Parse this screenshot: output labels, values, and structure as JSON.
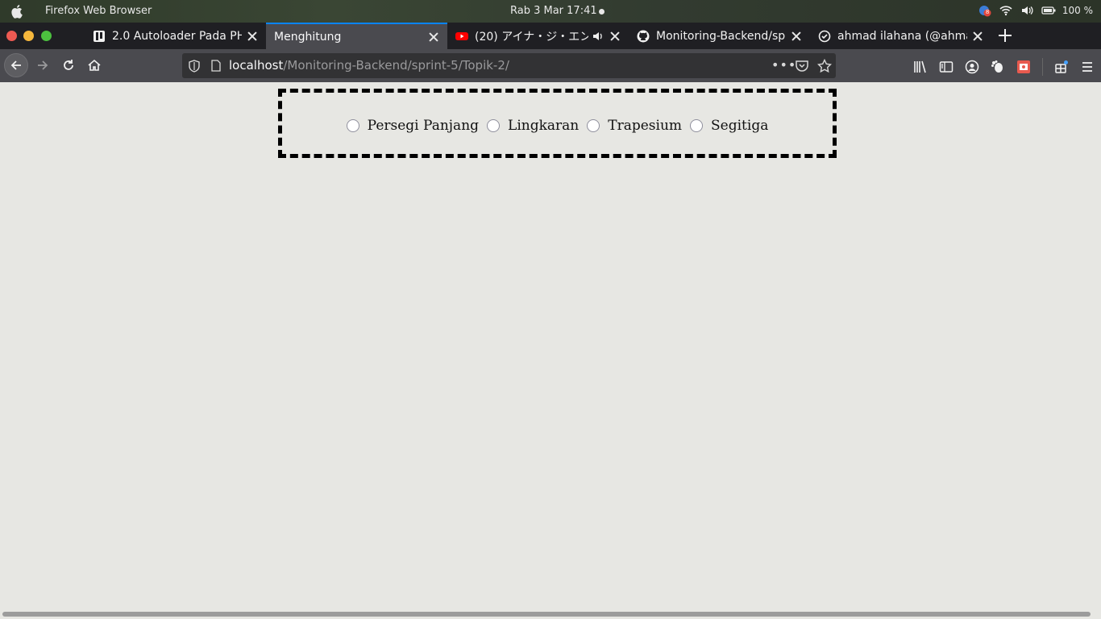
{
  "system_bar": {
    "app_name": "Firefox Web Browser",
    "clock": "Rab  3 Mar  17:41",
    "battery": "100 %",
    "notification_count": "8"
  },
  "tabs": [
    {
      "title": "2.0 Autoloader Pada PHP",
      "icon": "book-icon"
    },
    {
      "title": "Menghitung",
      "icon": "",
      "active": true
    },
    {
      "title": "(20) アイナ・ジ・エンド",
      "icon": "youtube-icon"
    },
    {
      "title": "Monitoring-Backend/sprint",
      "icon": "github-icon"
    },
    {
      "title": "ahmad ilahana (@ahmad",
      "icon": "circle-check-icon"
    }
  ],
  "url": {
    "host": "localhost",
    "path": "/Monitoring-Backend/sprint-5/Topik-2/"
  },
  "form": {
    "options": [
      {
        "label": "Persegi Panjang"
      },
      {
        "label": "Lingkaran"
      },
      {
        "label": "Trapesium"
      },
      {
        "label": "Segitiga"
      }
    ]
  },
  "colors": {
    "accent": "#0a84ff",
    "tabstrip": "#1f1f23",
    "toolbar": "#4a4a4f",
    "page_bg": "#e7e7e3"
  }
}
